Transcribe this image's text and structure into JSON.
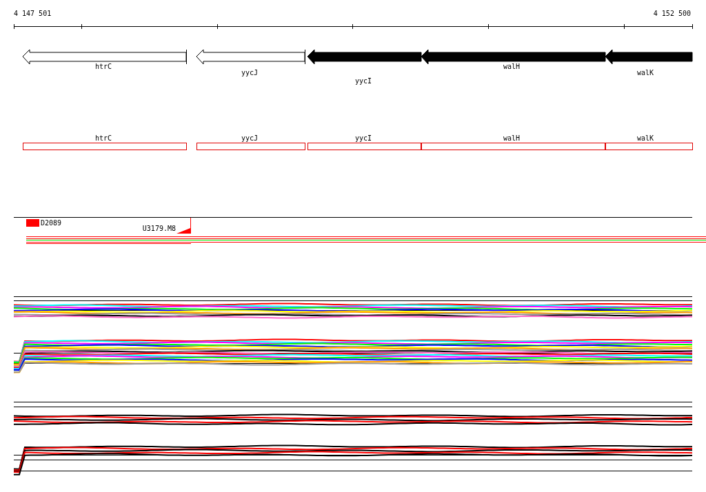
{
  "ruler": {
    "start_label": "4 147 501",
    "end_label": "4 152 500"
  },
  "genes": [
    {
      "name": "htrC",
      "filled": false
    },
    {
      "name": "yycJ",
      "filled": false
    },
    {
      "name": "yycI",
      "filled": true
    },
    {
      "name": "walH",
      "filled": true
    },
    {
      "name": "walK",
      "filled": true
    }
  ],
  "annotation_boxes": [
    {
      "name": "htrC"
    },
    {
      "name": "yycJ"
    },
    {
      "name": "yycI"
    },
    {
      "name": "walH"
    },
    {
      "name": "walK"
    }
  ],
  "features": [
    {
      "name": "D2089"
    },
    {
      "name": "U3179.M8"
    }
  ]
}
